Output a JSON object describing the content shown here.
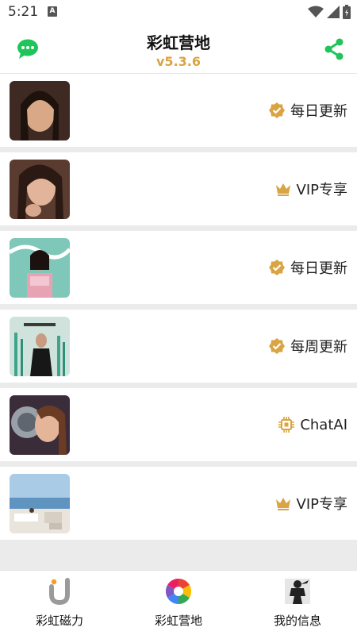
{
  "status": {
    "time": "5:21",
    "notif": "A"
  },
  "header": {
    "title": "彩虹营地",
    "version": "v5.3.6"
  },
  "colors": {
    "accent": "#d9a441",
    "chat": "#1fc45a",
    "share": "#1fc45a"
  },
  "cards": [
    {
      "badge_icon": "verified-icon",
      "badge": "每日更新"
    },
    {
      "badge_icon": "crown-icon",
      "badge": "VIP专享"
    },
    {
      "badge_icon": "verified-icon",
      "badge": "每日更新"
    },
    {
      "badge_icon": "verified-icon",
      "badge": "每周更新"
    },
    {
      "badge_icon": "chip-icon",
      "badge": "ChatAI"
    },
    {
      "badge_icon": "crown-icon",
      "badge": "VIP专享"
    }
  ],
  "nav": [
    {
      "icon": "magnet-u-icon",
      "label": "彩虹磁力"
    },
    {
      "icon": "rainbow-aperture-icon",
      "label": "彩虹营地"
    },
    {
      "icon": "ninja-avatar-icon",
      "label": "我的信息"
    }
  ]
}
